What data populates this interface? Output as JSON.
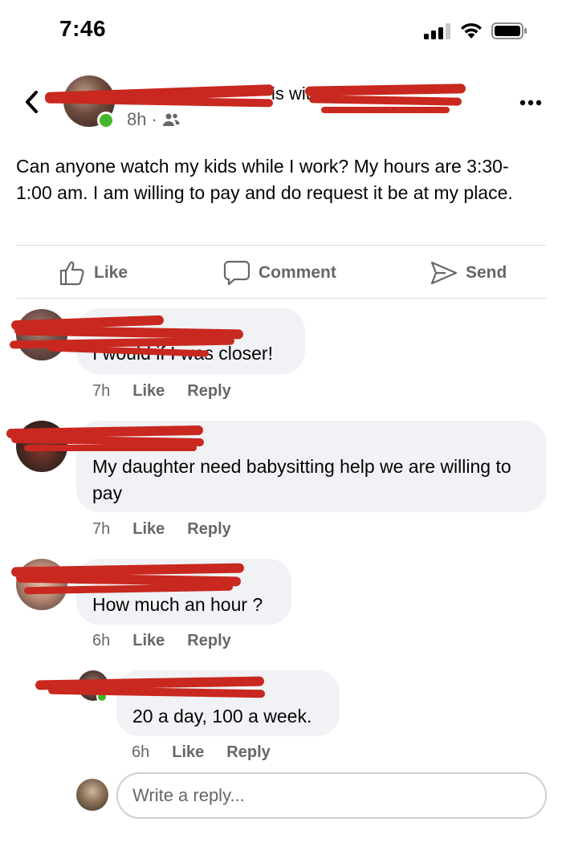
{
  "status_bar": {
    "time": "7:46",
    "icons": [
      "cellular-signal-icon",
      "wifi-icon",
      "battery-icon"
    ]
  },
  "post": {
    "author_visible": "is with",
    "time": "8h",
    "audience_icon": "friends-icon",
    "text": "Can anyone watch my kids while I work? My hours are 3:30-1:00 am. I am willing to pay and do request it be at my place."
  },
  "actions": {
    "like": "Like",
    "comment": "Comment",
    "send": "Send"
  },
  "comments": [
    {
      "text": "I would if I was closer!",
      "time": "7h",
      "like": "Like",
      "reply": "Reply"
    },
    {
      "text": "My daughter need babysitting help we are willing to pay",
      "time": "7h",
      "like": "Like",
      "reply": "Reply"
    },
    {
      "text": "How much an hour ?",
      "time": "6h",
      "like": "Like",
      "reply": "Reply"
    },
    {
      "text": "20 a day, 100 a week.",
      "time": "6h",
      "like": "Like",
      "reply": "Reply"
    }
  ],
  "reply_box": {
    "placeholder": "Write a reply..."
  },
  "colors": {
    "redaction": "#c8281f",
    "online": "#42b72a",
    "bubble": "#f0f2f5",
    "secondary_text": "#65676b"
  }
}
